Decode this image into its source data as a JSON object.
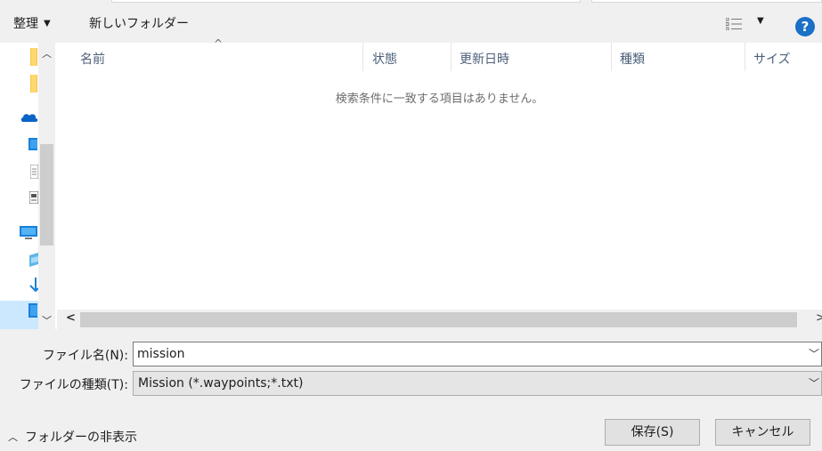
{
  "toolbar": {
    "organize_label": "整理",
    "new_folder_label": "新しいフォルダー",
    "help_label": "?"
  },
  "columns": [
    "名前",
    "状態",
    "更新日時",
    "種類",
    "サイズ"
  ],
  "empty_message": "検索条件に一致する項目はありません。",
  "form": {
    "filename_label": "ファイル名(N):",
    "filename_value": "mission",
    "filetype_label": "ファイルの種類(T):",
    "filetype_value": "Mission (*.waypoints;*.txt)"
  },
  "footer": {
    "hide_folders_label": "フォルダーの非表示",
    "save_label": "保存(S)",
    "cancel_label": "キャンセル"
  },
  "icons": {
    "organize_caret": "caret-down-icon",
    "view": "details-view-icon",
    "help": "help-icon",
    "nav": [
      "folder-icon",
      "folder-icon",
      "onedrive-cloud-icon",
      "desktop-icon",
      "document-icon",
      "document-icon",
      "pc-monitor-icon",
      "3d-objects-icon",
      "download-icon",
      "desktop-icon"
    ]
  },
  "colors": {
    "help_blue": "#1a6fc7",
    "onedrive_blue": "#0a64c8",
    "selection": "#cce8ff",
    "header_text": "#4c607a"
  }
}
